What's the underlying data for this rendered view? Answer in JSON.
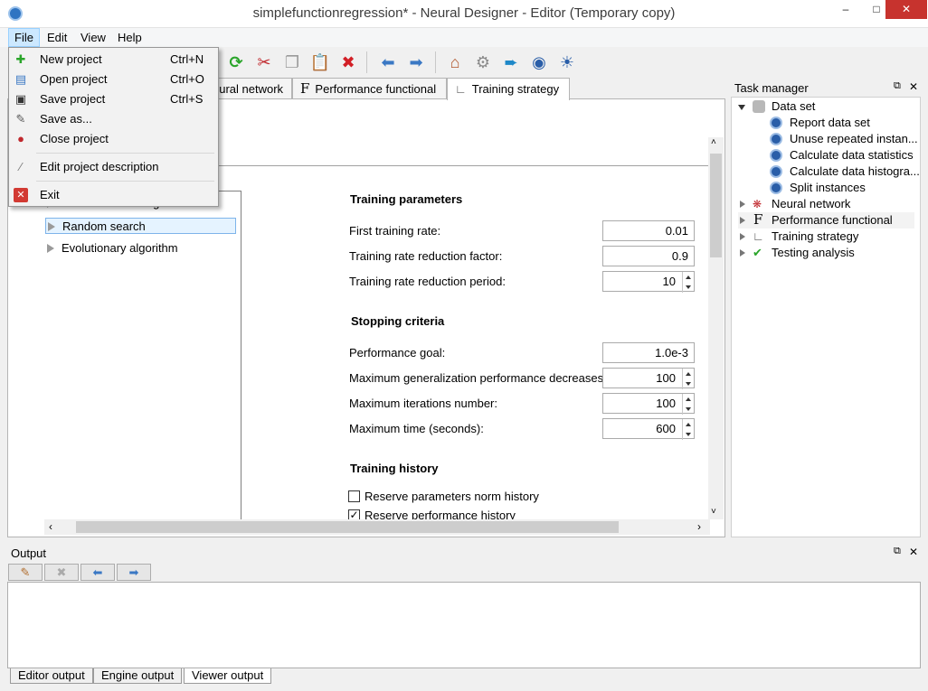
{
  "window": {
    "title": "simplefunctionregression* - Neural Designer - Editor (Temporary copy)"
  },
  "menubar": {
    "items": [
      "File",
      "Edit",
      "View",
      "Help"
    ]
  },
  "file_menu": {
    "items": [
      {
        "label": "New project",
        "shortcut": "Ctrl+N",
        "icon": "new-project-icon"
      },
      {
        "label": "Open project",
        "shortcut": "Ctrl+O",
        "icon": "open-project-icon"
      },
      {
        "label": "Save project",
        "shortcut": "Ctrl+S",
        "icon": "save-icon"
      },
      {
        "label": "Save as...",
        "shortcut": "",
        "icon": "save-as-icon"
      },
      {
        "label": "Close project",
        "shortcut": "",
        "icon": "close-project-icon"
      },
      {
        "label": "Edit project description",
        "shortcut": "",
        "icon": "edit-description-icon"
      },
      {
        "label": "Exit",
        "shortcut": "",
        "icon": "exit-icon"
      }
    ]
  },
  "tabs": [
    {
      "label": "eural network"
    },
    {
      "label": "Performance functional"
    },
    {
      "label": "Training strategy"
    }
  ],
  "editor": {
    "tree_items": [
      "No initialization algorithm",
      "Random search",
      "Evolutionary algorithm"
    ],
    "training_parameters": {
      "title": "Training parameters",
      "rows": [
        {
          "label": "First training rate:",
          "value": "0.01"
        },
        {
          "label": "Training rate reduction factor:",
          "value": "0.9"
        },
        {
          "label": "Training rate reduction period:",
          "value": "10"
        }
      ]
    },
    "stopping_criteria": {
      "title": "Stopping criteria",
      "rows": [
        {
          "label": "Performance goal:",
          "value": "1.0e-3"
        },
        {
          "label": "Maximum generalization performance decreases:",
          "value": "100"
        },
        {
          "label": "Maximum iterations number:",
          "value": "100"
        },
        {
          "label": "Maximum time (seconds):",
          "value": "600"
        }
      ]
    },
    "training_history": {
      "title": "Training history",
      "checks": [
        {
          "label": "Reserve parameters norm history",
          "checked": false
        },
        {
          "label": "Reserve performance history",
          "checked": true
        }
      ]
    }
  },
  "task_manager": {
    "title": "Task manager",
    "data_set": "Data set",
    "data_set_children": [
      "Report data set",
      "Unuse repeated instan...",
      "Calculate data statistics",
      "Calculate data histogra...",
      "Split instances"
    ],
    "items": [
      "Neural network",
      "Performance functional",
      "Training strategy",
      "Testing analysis"
    ]
  },
  "output": {
    "title": "Output",
    "bottom_tabs": [
      "Editor output",
      "Engine output",
      "Viewer output"
    ]
  },
  "colors": {
    "close_red": "#c7332e",
    "selection": "#cce8ff",
    "accent_blue": "#2a5ea8"
  }
}
